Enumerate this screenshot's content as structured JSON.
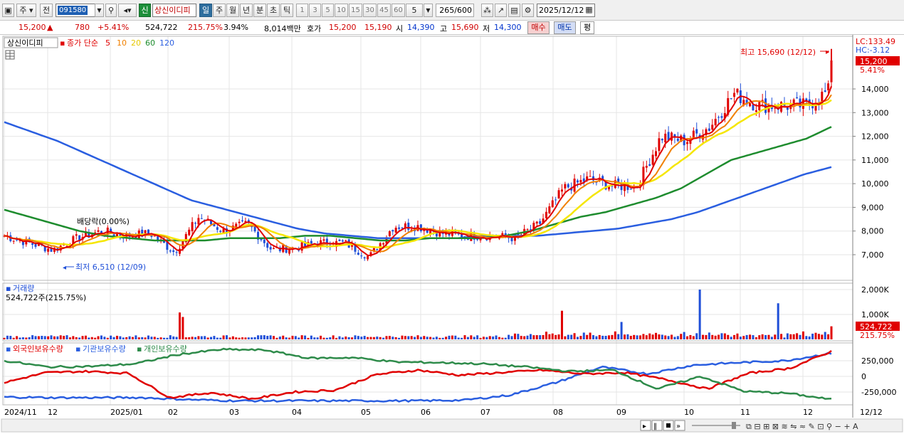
{
  "toolbar": {
    "market_label": "주",
    "prev_label": "전",
    "stock_code": "091580",
    "sin_label": "신",
    "stock_name": "상신이디피",
    "period_buttons": [
      "일",
      "주",
      "월",
      "년",
      "분",
      "초",
      "틱"
    ],
    "interval_buttons": [
      "1",
      "3",
      "5",
      "10",
      "15",
      "30",
      "45",
      "60"
    ],
    "interval_value": "5",
    "count_value": "265",
    "count_total": "/600",
    "date_value": "2025/12/12"
  },
  "info": {
    "price": "15,200",
    "change_arrow": "▲",
    "change": "780",
    "change_pct": "+5.41%",
    "volume": "524,722",
    "volume_ratio": "215.75%",
    "turnover": "3.94%",
    "amount": "8,014백만",
    "quote_label": "호가",
    "ask": "15,200",
    "bid": "15,190",
    "open_label": "시",
    "open": "14,390",
    "high_label": "고",
    "high": "15,690",
    "low_label": "저",
    "low": "14,300",
    "buy_label": "매수",
    "sell_label": "매도",
    "avg_label": "평"
  },
  "legend": {
    "stock_name": "상신이디피",
    "ma_label": "종가 단순",
    "ma5": "5",
    "ma10": "10",
    "ma20": "20",
    "ma60": "60",
    "ma120": "120"
  },
  "price_axis": {
    "ticks": [
      "14,000",
      "13,000",
      "12,000",
      "11,000",
      "10,000",
      "9,000",
      "8,000",
      "7,000"
    ],
    "lc": "LC:133.49",
    "hc": "HC:-3.12",
    "current_tag": "15,200",
    "current_pct": "5.41%"
  },
  "annotations": {
    "high_label": "최고 15,690 (12/12)",
    "low_label": "최저 6,510 (12/09)",
    "dividend_label": "배당락(0.00%)"
  },
  "volume_panel": {
    "title": "거래량",
    "value_text": "524,722주(215.75%)",
    "ticks": [
      "2,000K",
      "1,000K"
    ],
    "current_tag": "524,722",
    "current_pct": "215.75%"
  },
  "holdings_panel": {
    "legend_foreign": "외국인보유수량",
    "legend_inst": "기관보유수량",
    "legend_indiv": "개인보유수량",
    "ticks": [
      "250,000",
      "0",
      "-250,000"
    ]
  },
  "x_axis": {
    "labels": [
      "2024/11",
      "12",
      "2025/01",
      "02",
      "03",
      "04",
      "05",
      "06",
      "07",
      "08",
      "09",
      "10",
      "11",
      "12"
    ],
    "right_label": "12/12"
  },
  "colors": {
    "up": "#e00000",
    "down": "#1f4fd8",
    "ma5": "#e00000",
    "ma10": "#f08000",
    "ma20": "#f5e600",
    "ma60": "#1e8c2e",
    "ma120": "#2a5ee0",
    "foreign": "#2a5ee0",
    "inst": "#e00000",
    "indiv": "#2e8b4a"
  },
  "chart_data": [
    {
      "type": "candlestick",
      "title": "상신이디피",
      "x_range": [
        "2024/11",
        "2025/12/12"
      ],
      "y_range": [
        6500,
        15700
      ],
      "series": [
        {
          "name": "5",
          "type": "line",
          "values": [
            7800,
            7500,
            7200,
            7700,
            8000,
            7800,
            7900,
            7100,
            8600,
            8000,
            8300,
            7200,
            7300,
            7500,
            7500,
            6900,
            8200,
            8200,
            7900,
            7800,
            7800,
            7700,
            8300,
            9800,
            10200,
            9900,
            9900,
            12000,
            11800,
            12400,
            13800,
            13300,
            13300,
            13300,
            14000
          ]
        },
        {
          "name": "10",
          "type": "line"
        },
        {
          "name": "20",
          "type": "line"
        },
        {
          "name": "60",
          "type": "line",
          "values": [
            8900,
            8600,
            8300,
            8000,
            7800,
            7700,
            7600,
            7600,
            7600,
            7700,
            7700,
            7700,
            7800,
            7800,
            7700,
            7600,
            7600,
            7700,
            7700,
            7700,
            7800,
            8000,
            8300,
            8600,
            8800,
            9100,
            9400,
            9800,
            10400,
            11000,
            11300,
            11600,
            11900,
            12400
          ]
        },
        {
          "name": "120",
          "type": "line",
          "values": [
            12600,
            12200,
            11800,
            11300,
            10800,
            10300,
            9800,
            9300,
            9000,
            8700,
            8400,
            8100,
            7900,
            7800,
            7700,
            7700,
            7700,
            7700,
            7800,
            7800,
            7800,
            7900,
            8000,
            8100,
            8300,
            8500,
            8800,
            9200,
            9600,
            10000,
            10400,
            10700
          ]
        }
      ],
      "high": {
        "value": 15690,
        "date": "12/12"
      },
      "low": {
        "value": 6510,
        "date": "12/09"
      },
      "current": 15200
    },
    {
      "type": "bar",
      "title": "거래량",
      "y_range": [
        0,
        2000000
      ],
      "notable_values": [
        {
          "date": "2025/10",
          "value": 2000000
        },
        {
          "date": "2025/11",
          "value": 1450000
        },
        {
          "date": "2025/08",
          "value": 1150000
        },
        {
          "date": "2025/02",
          "value": 1080000
        }
      ],
      "current": 524722
    },
    {
      "type": "line",
      "y_range": [
        -400000,
        400000
      ],
      "series": [
        {
          "name": "외국인보유수량",
          "values": [
            -330000,
            -340000,
            -340000,
            -340000,
            -370000,
            -390000,
            -390000,
            -390000,
            -390000,
            -390000,
            -380000,
            -300000,
            -100000,
            150000,
            40000,
            180000,
            220000,
            250000,
            370000
          ]
        },
        {
          "name": "기관보유수량",
          "values": [
            -100000,
            60000,
            80000,
            50000,
            -340000,
            -260000,
            -360000,
            -250000,
            -220000,
            30000,
            100000,
            20000,
            60000,
            100000,
            40000,
            60000,
            -50000,
            -200000,
            50000,
            130000,
            400000
          ]
        },
        {
          "name": "개인보유수량",
          "values": [
            250000,
            150000,
            160000,
            200000,
            350000,
            430000,
            420000,
            290000,
            300000,
            230000,
            220000,
            200000,
            150000,
            80000,
            100000,
            -200000,
            0,
            -240000,
            -270000,
            -370000
          ]
        }
      ]
    }
  ]
}
